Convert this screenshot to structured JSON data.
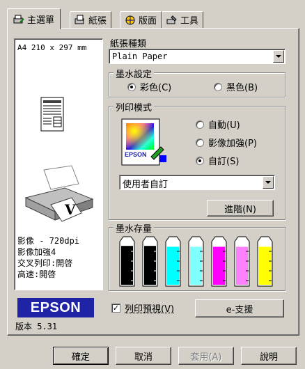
{
  "tabs": [
    {
      "label": "主選單",
      "icon": "printer-settings-icon"
    },
    {
      "label": "紙張",
      "icon": "paper-icon"
    },
    {
      "label": "版面",
      "icon": "layout-icon"
    },
    {
      "label": "工具",
      "icon": "tools-icon"
    }
  ],
  "preview": {
    "paper_size": "A4 210 x 297 mm",
    "summary": [
      "影像 - 720dpi",
      "影像加強4",
      "交叉列印:開啓",
      "高速:開啓"
    ]
  },
  "media_type": {
    "label": "紙張種類",
    "value": "Plain Paper"
  },
  "ink": {
    "title": "墨水設定",
    "color_label": "彩色(C)",
    "black_label": "黑色(B)"
  },
  "mode": {
    "title": "列印模式",
    "automatic_label": "自動(U)",
    "photo_enhance_label": "影像加強(P)",
    "custom_label": "自訂(S)",
    "custom_value": "使用者自訂",
    "advanced_label": "進階(N)",
    "epson_label": "EPSON"
  },
  "ink_levels": {
    "title": "墨水存量",
    "cartridges": [
      {
        "color": "#000000",
        "level": 0.9
      },
      {
        "color": "#000000",
        "level": 0.9
      },
      {
        "color": "#00ffff",
        "level": 0.88
      },
      {
        "color": "#80ffff",
        "level": 0.88
      },
      {
        "color": "#ff00ff",
        "level": 0.88
      },
      {
        "color": "#ff80ff",
        "level": 0.88
      },
      {
        "color": "#ffff00",
        "level": 0.88
      }
    ]
  },
  "brand": {
    "logo": "EPSON",
    "version": "版本 5.31"
  },
  "print_preview": {
    "label": "列印預視(V)",
    "checked": true
  },
  "esupport_label": "e-支援",
  "footer": {
    "ok": "確定",
    "cancel": "取消",
    "apply": "套用(A)",
    "help": "說明"
  }
}
